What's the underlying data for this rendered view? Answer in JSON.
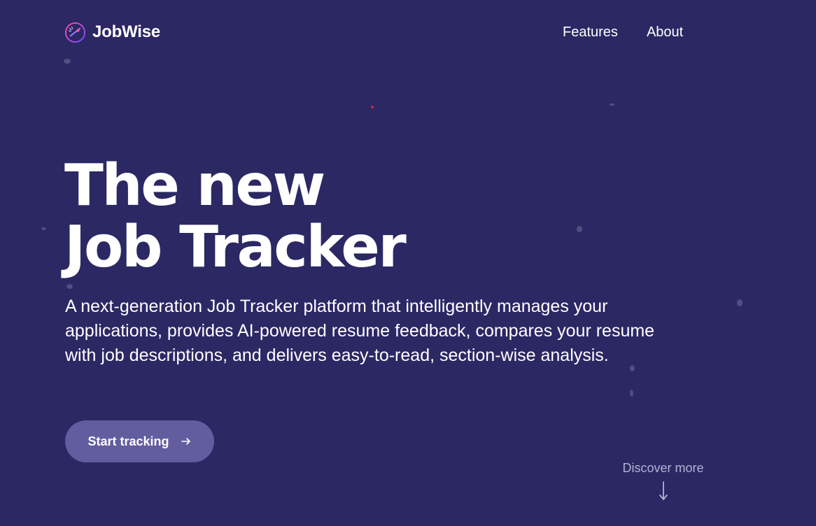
{
  "brand": {
    "name": "JobWise",
    "logo_icon": "compass-logo-icon"
  },
  "nav": {
    "items": [
      {
        "label": "Features"
      },
      {
        "label": "About"
      }
    ]
  },
  "hero": {
    "title_line1": "The new",
    "title_line2": "Job Tracker",
    "description": "A next-generation Job Tracker platform that intelligently manages your applications, provides AI-powered resume feedback, compares your resume with job descriptions, and delivers easy-to-read, section-wise analysis.",
    "cta_label": "Start tracking",
    "cta_icon": "arrow-right-icon"
  },
  "discover": {
    "label": "Discover more",
    "icon": "arrow-down-icon"
  },
  "colors": {
    "background": "#2b2864",
    "button": "#625d9f",
    "muted_text": "#b3b1d3",
    "logo_accent": "#7b4bff"
  }
}
